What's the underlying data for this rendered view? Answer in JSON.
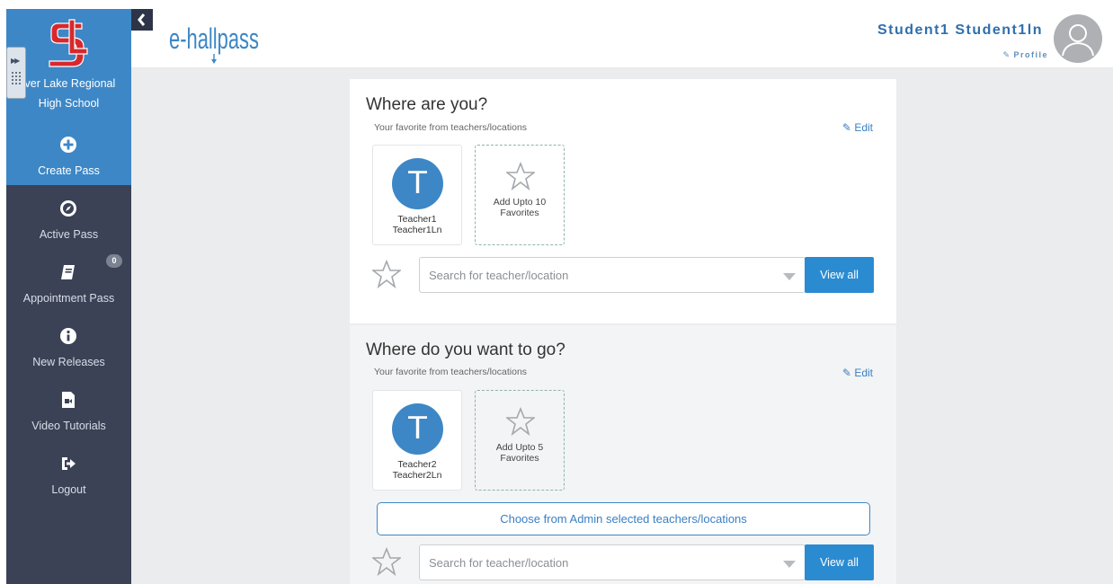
{
  "school": {
    "name": "lver Lake Regional\nHigh School",
    "logo_color": "#d8282d"
  },
  "sidebar": {
    "items": [
      {
        "label": "Create Pass",
        "icon": "plus-circle-icon",
        "active": true
      },
      {
        "label": "Active Pass",
        "icon": "compass-icon",
        "active": false
      },
      {
        "label": "Appointment Pass",
        "icon": "book-icon",
        "active": false,
        "badge": "0"
      },
      {
        "label": "New Releases",
        "icon": "info-circle-icon",
        "active": false
      },
      {
        "label": "Video Tutorials",
        "icon": "video-file-icon",
        "active": false
      },
      {
        "label": "Logout",
        "icon": "sign-out-icon",
        "active": false
      }
    ]
  },
  "header": {
    "brand": "e-hallpass",
    "user_name": "Student1 Student1ln",
    "profile_label": "Profile"
  },
  "where_are_you": {
    "title": "Where are you?",
    "subtitle": "Your favorite from teachers/locations",
    "edit_label": "Edit",
    "favorites": [
      {
        "initial": "T",
        "name": "Teacher1\nTeacher1Ln"
      }
    ],
    "add_label": "Add Upto 10\nFavorites",
    "search_placeholder": "Search for teacher/location",
    "view_all_label": "View all"
  },
  "where_to_go": {
    "title": "Where do you want to go?",
    "subtitle": "Your favorite from teachers/locations",
    "edit_label": "Edit",
    "favorites": [
      {
        "initial": "T",
        "name": "Teacher2\nTeacher2Ln"
      }
    ],
    "add_label": "Add Upto 5\nFavorites",
    "admin_button_label": "Choose from Admin selected teachers/locations",
    "search_placeholder": "Search for teacher/location",
    "view_all_label": "View all"
  },
  "colors": {
    "accent": "#3d87c6",
    "sidebar_bg": "#3b4256",
    "button_blue": "#2b8bd1",
    "user_name_blue": "#2f6fac"
  }
}
